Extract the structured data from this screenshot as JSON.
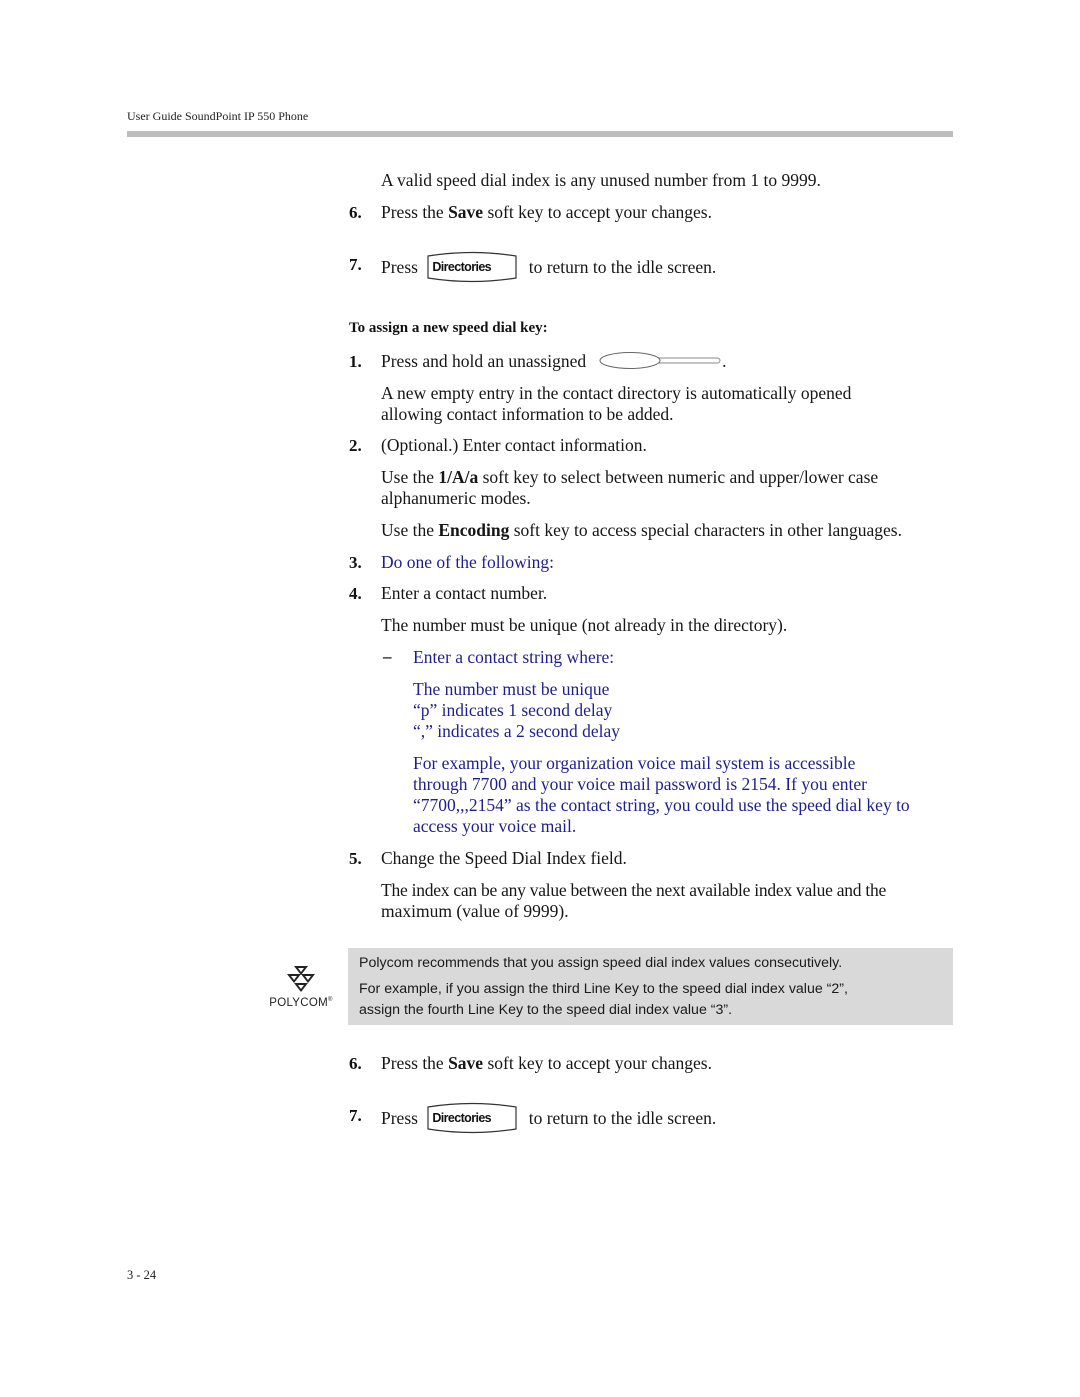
{
  "header": {
    "title": "User Guide SoundPoint IP 550 Phone"
  },
  "section_top": {
    "intro": "A valid speed dial index is any unused number from 1 to 9999.",
    "step6": {
      "num": "6.",
      "pre": "Press the ",
      "bold": "Save",
      "post": " soft key to accept your changes."
    },
    "step7": {
      "num": "7.",
      "pre": "Press",
      "key_label": "Directories",
      "post": "to return to the idle screen."
    }
  },
  "procedure": {
    "heading": "To assign a new speed dial key:",
    "step1": {
      "num": "1.",
      "text": "Press and hold an unassigned",
      "after": ".",
      "icon": "line-key-icon"
    },
    "step1_desc": [
      "A new empty entry in the contact directory is automatically opened",
      "allowing contact information to be added."
    ],
    "step2": {
      "num": "2.",
      "text": "(Optional.) Enter contact information."
    },
    "step2_desc1": {
      "pre": "Use the ",
      "bold": "1/A/a",
      "post": " soft key to select between numeric and upper/lower case",
      "line2": "alphanumeric modes."
    },
    "step2_desc2": {
      "pre": "Use the ",
      "bold": "Encoding",
      "post": " soft key to access special characters in other languages."
    },
    "step3": {
      "num": "3.",
      "text": "Do one of the following:"
    },
    "step4": {
      "num": "4.",
      "text": "Enter a contact number."
    },
    "step4_desc": "The number must be unique (not already in the directory).",
    "bullet": {
      "mark": "–",
      "text": "Enter a contact string where:"
    },
    "rules": [
      "The number must be unique",
      "“p” indicates 1 second delay",
      "“,” indicates a 2 second delay"
    ],
    "example": [
      "For example, your organization voice mail system is accessible",
      "through 7700 and your voice mail password is 2154. If you enter",
      "“7700,,,2154” as the contact string, you could use the speed dial key to",
      "access your voice mail."
    ],
    "step5": {
      "num": "5.",
      "text": "Change the Speed Dial Index field."
    },
    "step5_desc": [
      "The index can be any value between the next available index value and the",
      "maximum (value of 9999)."
    ],
    "step6": {
      "num": "6.",
      "pre": "Press the ",
      "bold": "Save",
      "post": " soft key to accept your changes."
    },
    "step7": {
      "num": "7.",
      "pre": "Press",
      "key_label": "Directories",
      "post": "to return to the idle screen."
    }
  },
  "note": {
    "line1": "Polycom recommends that you assign speed dial index values consecutively.",
    "line2": "For example, if you assign the third Line Key to the speed dial index value “2”,",
    "line3": "assign the fourth Line Key to the speed dial index value “3”.",
    "logo_text": "POLYCOM",
    "logo_mark": "®"
  },
  "colors": {
    "link_blue": "#1f1f8c",
    "note_bg": "#d9d9d9",
    "rule": "#bdbdbd"
  },
  "footer": {
    "page_number": "3 - 24"
  }
}
